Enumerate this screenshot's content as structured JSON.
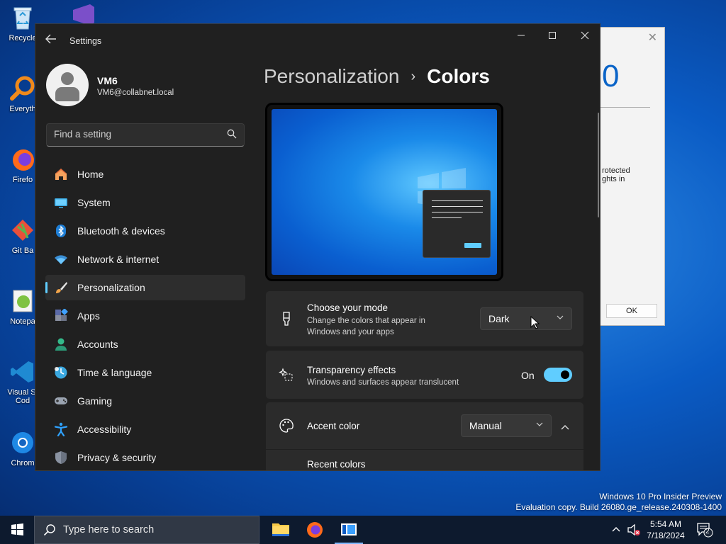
{
  "desktop": {
    "icons": [
      {
        "label": "Recycle"
      },
      {
        "label": "Everyth"
      },
      {
        "label": "Firefo"
      },
      {
        "label": "Git Ba"
      },
      {
        "label": "Notepa"
      },
      {
        "label": "Visual St Cod"
      },
      {
        "label": "Chrom"
      }
    ],
    "watermark": {
      "line1": "Windows 10 Pro Insider Preview",
      "line2": "Evaluation copy. Build 26080.ge_release.240308-1400"
    }
  },
  "background_dialog": {
    "close": "✕",
    "big_text": "0",
    "text": "rotected ghts in",
    "ok_label": "OK"
  },
  "window": {
    "title": "Settings",
    "back_icon": "back-arrow-icon"
  },
  "profile": {
    "name": "VM6",
    "email": "VM6@collabnet.local"
  },
  "search": {
    "placeholder": "Find a setting"
  },
  "nav": {
    "items": [
      {
        "label": "Home",
        "icon": "home-icon"
      },
      {
        "label": "System",
        "icon": "system-icon"
      },
      {
        "label": "Bluetooth & devices",
        "icon": "bluetooth-icon"
      },
      {
        "label": "Network & internet",
        "icon": "wifi-icon"
      },
      {
        "label": "Personalization",
        "icon": "brush-icon",
        "active": true
      },
      {
        "label": "Apps",
        "icon": "apps-icon"
      },
      {
        "label": "Accounts",
        "icon": "accounts-icon"
      },
      {
        "label": "Time & language",
        "icon": "clock-globe-icon"
      },
      {
        "label": "Gaming",
        "icon": "gamepad-icon"
      },
      {
        "label": "Accessibility",
        "icon": "accessibility-icon"
      },
      {
        "label": "Privacy & security",
        "icon": "shield-icon"
      }
    ]
  },
  "main": {
    "breadcrumb": {
      "parent": "Personalization",
      "separator": "›",
      "current": "Colors"
    },
    "mode": {
      "title": "Choose your mode",
      "description": "Change the colors that appear in Windows and your apps",
      "value": "Dark"
    },
    "transparency": {
      "title": "Transparency effects",
      "description": "Windows and surfaces appear translucent",
      "state": "On"
    },
    "accent": {
      "title": "Accent color",
      "value": "Manual",
      "recent_label": "Recent colors"
    }
  },
  "taskbar": {
    "search_placeholder": "Type here to search",
    "time": "5:54 AM",
    "date": "7/18/2024",
    "notifications": "2"
  },
  "colors": {
    "accent": "#60cdff",
    "window_bg": "#202020",
    "card_bg": "#2b2b2b"
  }
}
